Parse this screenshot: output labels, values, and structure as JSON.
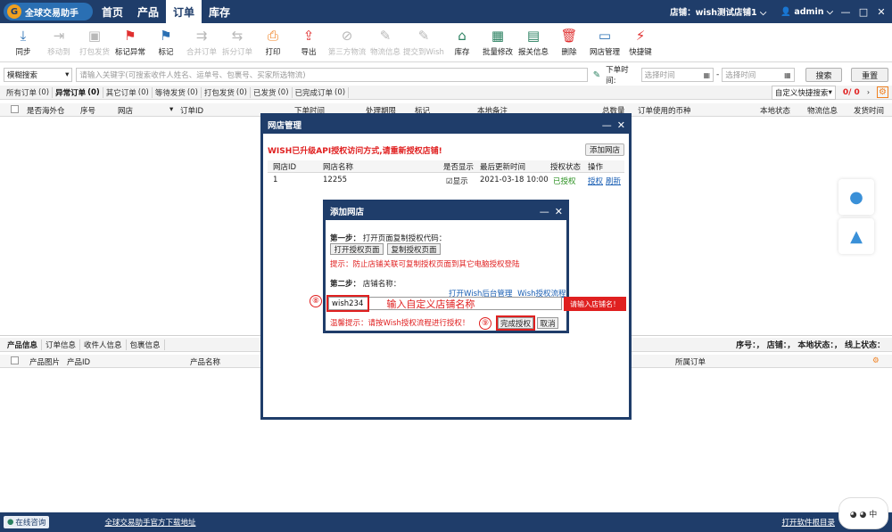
{
  "app": {
    "logo_text": "全球交易助手",
    "nav_tabs": [
      "首页",
      "产品",
      "订单",
      "库存"
    ],
    "store_label": "店铺：",
    "store_name": "wish测试店铺1",
    "user": "admin"
  },
  "toolbar": [
    {
      "label": "同步",
      "icon": "sync-icon",
      "color": "#2a6fb3",
      "disabled": false
    },
    {
      "label": "移动到",
      "icon": "move-icon",
      "color": "#b8b8b8",
      "disabled": true
    },
    {
      "label": "打包发货",
      "icon": "package-icon",
      "color": "#b8b8b8",
      "disabled": true
    },
    {
      "label": "标记异常",
      "icon": "flag-red-icon",
      "color": "#e03030",
      "disabled": false
    },
    {
      "label": "标记",
      "icon": "flag-blue-icon",
      "color": "#2a6fb3",
      "disabled": false
    },
    {
      "label": "合并订单",
      "icon": "merge-icon",
      "color": "#b8b8b8",
      "disabled": true
    },
    {
      "label": "拆分订单",
      "icon": "split-icon",
      "color": "#b8b8b8",
      "disabled": true
    },
    {
      "label": "打印",
      "icon": "print-icon",
      "color": "#f08020",
      "disabled": false
    },
    {
      "label": "导出",
      "icon": "export-icon",
      "color": "#e03030",
      "disabled": false
    },
    {
      "label": "第三方物流",
      "icon": "third-party-icon",
      "color": "#b8b8b8",
      "disabled": true
    },
    {
      "label": "物流信息",
      "icon": "logistics-icon",
      "color": "#b8b8b8",
      "disabled": true
    },
    {
      "label": "提交到Wish",
      "icon": "submit-icon",
      "color": "#b8b8b8",
      "disabled": true
    },
    {
      "label": "库存",
      "icon": "warehouse-icon",
      "color": "#2a8060",
      "disabled": false
    },
    {
      "label": "批量修改",
      "icon": "batch-edit-icon",
      "color": "#2a8060",
      "disabled": false
    },
    {
      "label": "报关信息",
      "icon": "customs-icon",
      "color": "#2a8060",
      "disabled": false
    },
    {
      "label": "删除",
      "icon": "delete-icon",
      "color": "#e03030",
      "disabled": false
    },
    {
      "label": "网店管理",
      "icon": "store-manage-icon",
      "color": "#2a6fb3",
      "disabled": false
    },
    {
      "label": "快捷键",
      "icon": "shortcut-icon",
      "color": "#e03030",
      "disabled": false
    }
  ],
  "search": {
    "mode": "模糊搜索",
    "placeholder": "请输入关键字(可搜索收件人姓名、运单号、包裹号、买家所选物流)",
    "order_time_label": "下单时间:",
    "time_placeholder": "选择时间",
    "dash": "-",
    "search_btn": "搜索",
    "reset_btn": "重置"
  },
  "status_tabs": [
    {
      "label": "所有订单",
      "count": "(0)",
      "active": false
    },
    {
      "label": "异常订单",
      "count": "(0)",
      "active": true
    },
    {
      "label": "其它订单",
      "count": "(0)",
      "active": false
    },
    {
      "label": "等待发货",
      "count": "(0)",
      "active": false
    },
    {
      "label": "打包发货",
      "count": "(0)",
      "active": false
    },
    {
      "label": "已发货",
      "count": "(0)",
      "active": false
    },
    {
      "label": "已完成订单",
      "count": "(0)",
      "active": false
    }
  ],
  "custom_search": "自定义快捷搜索",
  "page_counter": "0/ 0",
  "order_columns": {
    "overseas": "是否海外仓",
    "seq": "序号",
    "store": "网店",
    "order_id": "订单ID",
    "order_time": "下单时间",
    "deadline": "处理期限",
    "mark": "标记",
    "local_note": "本地备注",
    "qty": "总数量",
    "currency": "订单使用的币种",
    "local_status": "本地状态",
    "logistics": "物流信息",
    "ship_time": "发货时间"
  },
  "bottom": {
    "tabs": [
      "产品信息",
      "订单信息",
      "收件人信息",
      "包裹信息"
    ],
    "summary": "序号：，  店铺：，  本地状态：，  线上状态：",
    "col_image": "产品图片",
    "col_product_id": "产品ID",
    "col_product_name": "产品名称",
    "col_order": "所属订单"
  },
  "footer": {
    "online_consult": "在线咨询",
    "download_link": "全球交易助手官方下载地址",
    "open_dir": "打开软件根目录"
  },
  "dialog_store": {
    "title": "网店管理",
    "warning": "WISH已升级API授权访问方式,请重新授权店铺!",
    "add_btn": "添加网店",
    "columns": [
      "网店ID",
      "网店名称",
      "是否显示",
      "最后更新时间",
      "授权状态",
      "操作"
    ],
    "row": {
      "id": "1",
      "name": "12255",
      "show": "显示",
      "updated": "2021-03-18 10:00",
      "auth": "已授权",
      "action_auth": "授权",
      "action_refresh": "刷新"
    },
    "auth_color": "#2a9020"
  },
  "dialog_add": {
    "title": "添加网店",
    "step1_label": "第一步：",
    "step1_text": "打开页面复制授权代码：",
    "open_btn": "打开授权页面",
    "copy_btn": "复制授权页面",
    "tip": "提示：防止店铺关联可复制授权页面到其它电脑授权登陆",
    "step2_label": "第二步：",
    "step2_text": "店铺名称：",
    "link_backend": "打开Wish后台管理",
    "link_flow": "Wish授权流程",
    "name_value": "wish234",
    "annotation": "输入自定义店铺名称",
    "warm_tip": "温馨提示：请按Wish授权流程进行授权！",
    "finish_btn": "完成授权",
    "cancel_btn": "取消",
    "error_tooltip": "请输入店铺名！",
    "marker8": "⑧",
    "marker9": "⑨"
  }
}
